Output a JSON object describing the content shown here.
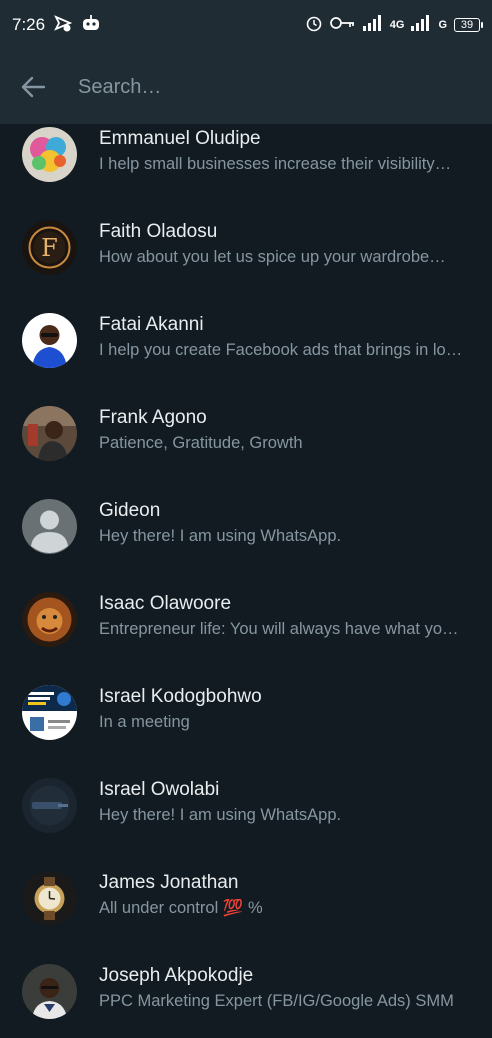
{
  "status": {
    "time": "7:26",
    "network": "4G",
    "sim2": "G",
    "battery": "39"
  },
  "search": {
    "placeholder": "Search…"
  },
  "contacts": [
    {
      "name": "Emmanuel Oludipe",
      "about": "I help small businesses increase their visibility…"
    },
    {
      "name": "Faith Oladosu",
      "about": "How about you let us spice up your wardrobe…"
    },
    {
      "name": "Fatai Akanni",
      "about": "I help you create Facebook ads that brings in lo…"
    },
    {
      "name": "Frank Agono",
      "about": "Patience, Gratitude, Growth"
    },
    {
      "name": "Gideon",
      "about": "Hey there! I am using WhatsApp."
    },
    {
      "name": "Isaac Olawoore",
      "about": "Entrepreneur life: You will always have what yo…"
    },
    {
      "name": "Israel Kodogbohwo",
      "about": "In a meeting"
    },
    {
      "name": "Israel Owolabi",
      "about": "Hey there! I am using WhatsApp."
    },
    {
      "name": "James Jonathan",
      "about": "All under control 💯 %"
    },
    {
      "name": "Joseph Akpokodje",
      "about": "PPC Marketing Expert (FB/IG/Google Ads) SMM"
    }
  ],
  "avatar_logo_text": "F",
  "colors": {
    "background": "#121b22",
    "header": "#1f2c34",
    "primary_text": "#e9edef",
    "secondary_text": "#8696a0"
  }
}
